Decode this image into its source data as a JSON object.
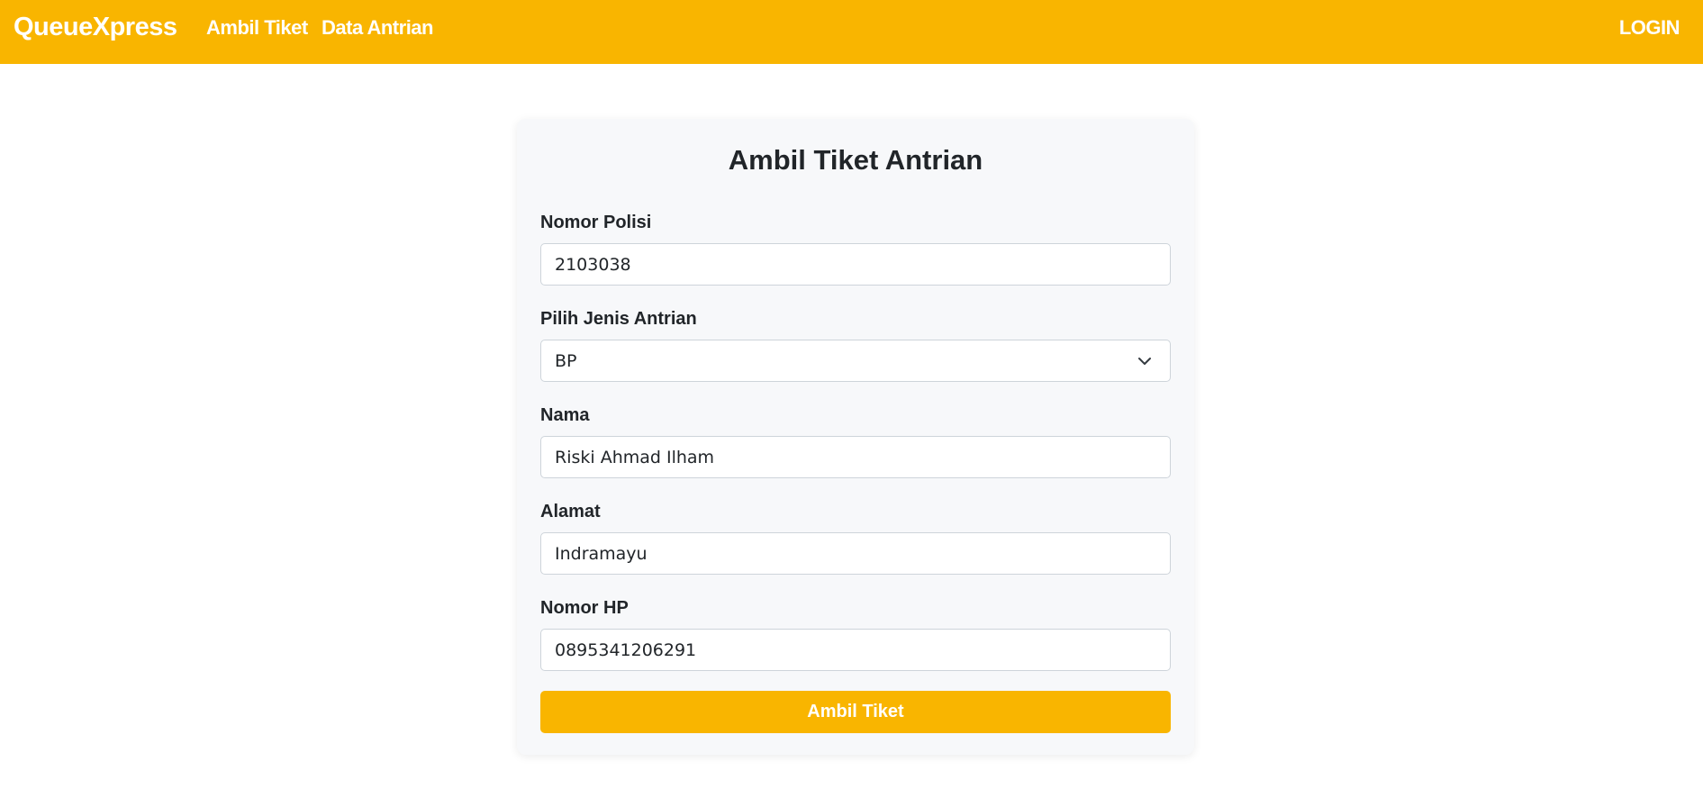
{
  "navbar": {
    "brand": "QueueXpress",
    "links": [
      "Ambil Tiket",
      "Data Antrian"
    ],
    "login": "LOGIN",
    "color": "#f9b500"
  },
  "form": {
    "title": "Ambil Tiket Antrian",
    "fields": [
      {
        "label": "Nomor Polisi",
        "value": "2103038"
      },
      {
        "label": "Pilih Jenis Antrian",
        "value": "BP",
        "icon": "chevron-down-icon"
      },
      {
        "label": "Nama",
        "value": "Riski Ahmad Ilham"
      },
      {
        "label": "Alamat",
        "value": "Indramayu"
      },
      {
        "label": "Nomor HP",
        "value": "0895341206291"
      }
    ],
    "submit_label": "Ambil Tiket"
  }
}
